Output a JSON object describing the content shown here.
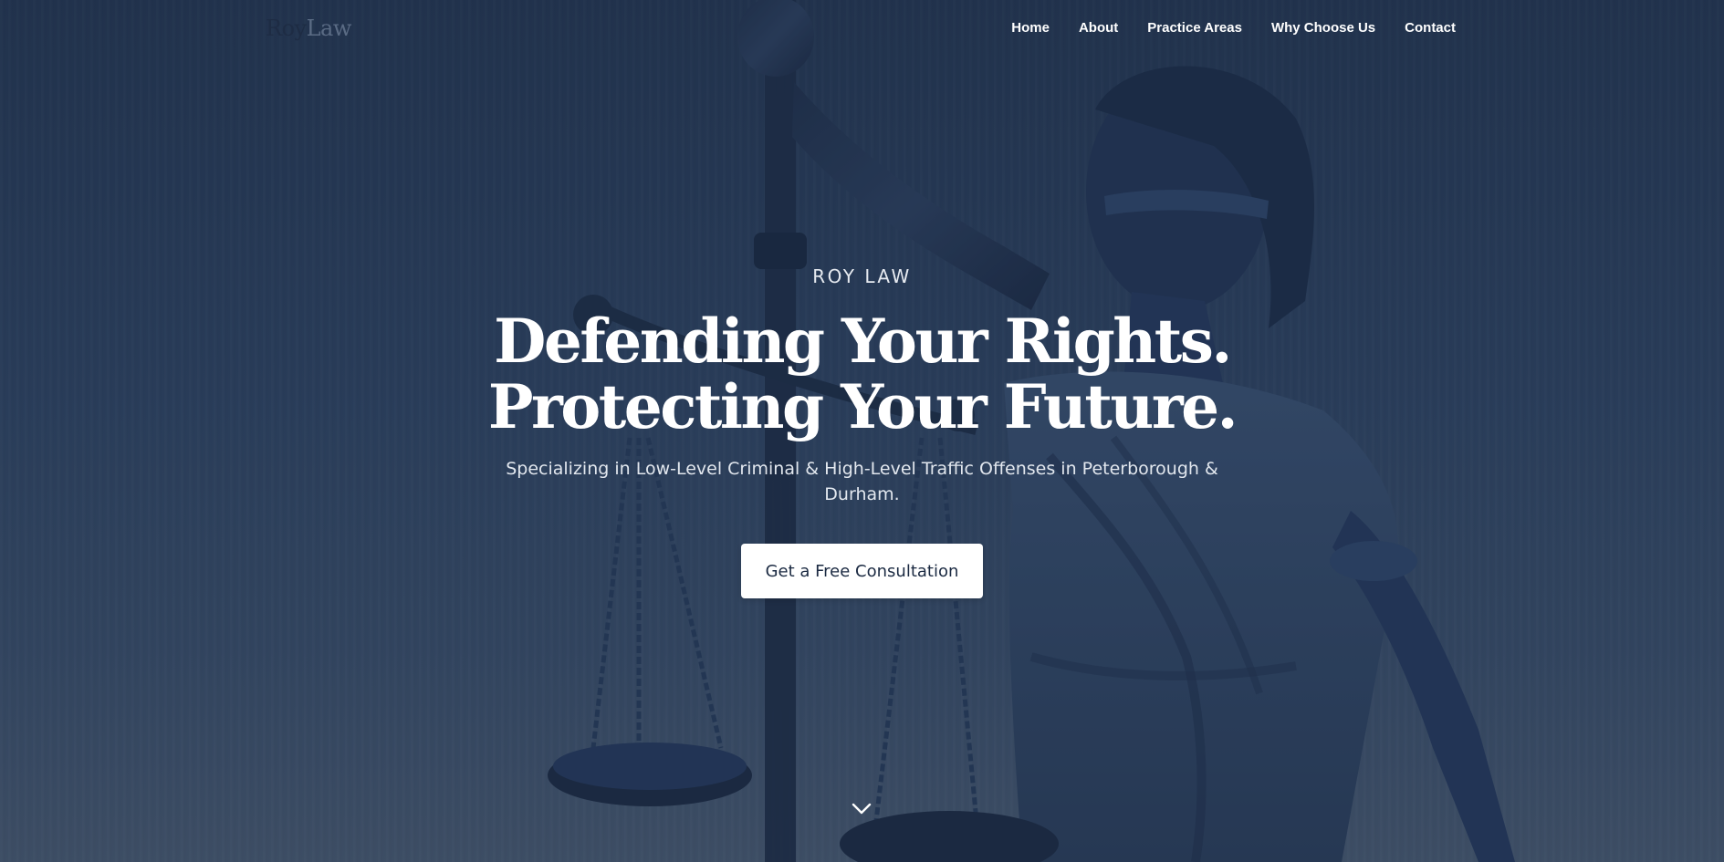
{
  "nav": {
    "logo_part1": "Roy",
    "logo_part2": "Law",
    "links": [
      "Home",
      "About",
      "Practice Areas",
      "Why Choose Us",
      "Contact"
    ]
  },
  "hero": {
    "eyebrow": "ROY LAW",
    "headline_line1": "Defending Your Rights.",
    "headline_line2": "Protecting Your Future.",
    "subtitle": "Specializing in Low-Level Criminal & High-Level Traffic Offenses in Peterborough & Durham.",
    "cta_label": "Get a Free Consultation",
    "background_image": "lady-justice-statue",
    "scroll_icon": "chevron-down-icon"
  },
  "colors": {
    "overlay": "#2e4260",
    "text": "#ffffff",
    "cta_background": "#ffffff",
    "cta_text": "#1b2a42",
    "logo_dark": "#1e2c44",
    "logo_light": "#5a6b84"
  }
}
